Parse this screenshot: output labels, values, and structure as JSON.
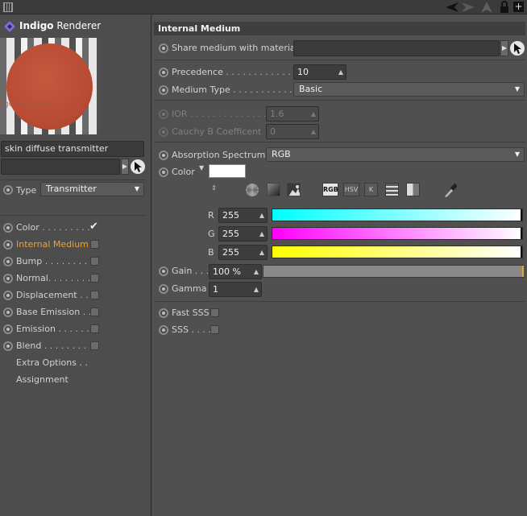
{
  "plugin": {
    "name_bold": "Indigo",
    "name_rest": " Renderer"
  },
  "preview": {
    "watermark": "Indigo Renderer"
  },
  "material_name": "skin diffuse transmitter",
  "left_type": {
    "label": "Type",
    "value": "Transmitter"
  },
  "channels": [
    {
      "label": "Color",
      "dots": " . . . . . . . . .",
      "checked": true
    },
    {
      "label": "Internal Medium",
      "dots": "",
      "checked": false,
      "active": true
    },
    {
      "label": "Bump",
      "dots": " . . . . . . . . .",
      "checked": false
    },
    {
      "label": "Normal",
      "dots": ". . . . . . . . .",
      "checked": false
    },
    {
      "label": "Displacement",
      "dots": " . .",
      "checked": false
    },
    {
      "label": "Base Emission",
      "dots": " . .",
      "checked": false
    },
    {
      "label": "Emission",
      "dots": " . . . . . .",
      "checked": false
    },
    {
      "label": "Blend",
      "dots": " . . . . . . . .",
      "checked": false
    }
  ],
  "extra_options": "Extra Options . .",
  "assignment": "Assignment",
  "section_title": "Internal Medium",
  "share_medium": {
    "label": "Share medium with material",
    "value": ""
  },
  "precedence": {
    "label": "Precedence",
    "dots": " . . . . . . . . . . . . . .",
    "value": "10"
  },
  "medium_type": {
    "label": "Medium Type",
    "dots": " . . . . . . . . . . . . .",
    "value": "Basic"
  },
  "ior": {
    "label": "IOR",
    "dots": " . . . . . . . . . . . . . . .",
    "value": "1.6"
  },
  "cauchy": {
    "label": "Cauchy B Coefficent",
    "value": "0"
  },
  "absorption": {
    "label": "Absorption Spectrum",
    "value": "RGB"
  },
  "color": {
    "label": "Color",
    "swatch": "#ffffff"
  },
  "color_modes": [
    "RGB",
    "HSV",
    "K"
  ],
  "rgb": [
    {
      "label": "R",
      "value": "255",
      "color": "#00ffff"
    },
    {
      "label": "G",
      "value": "255",
      "color": "#ff00ff"
    },
    {
      "label": "B",
      "value": "255",
      "color": "#ffff00"
    }
  ],
  "gain": {
    "label": "Gain",
    "dots": " . . .",
    "value": "100 %",
    "level": 1.0
  },
  "gamma": {
    "label": "Gamma",
    "value": "1"
  },
  "fast_sss": {
    "label": "Fast SSS"
  },
  "sss": {
    "label": "SSS",
    "dots": " . . . ."
  },
  "colors": {
    "accent": "#f0a030",
    "panel": "#505050",
    "sidebar": "#4d4d4d"
  }
}
